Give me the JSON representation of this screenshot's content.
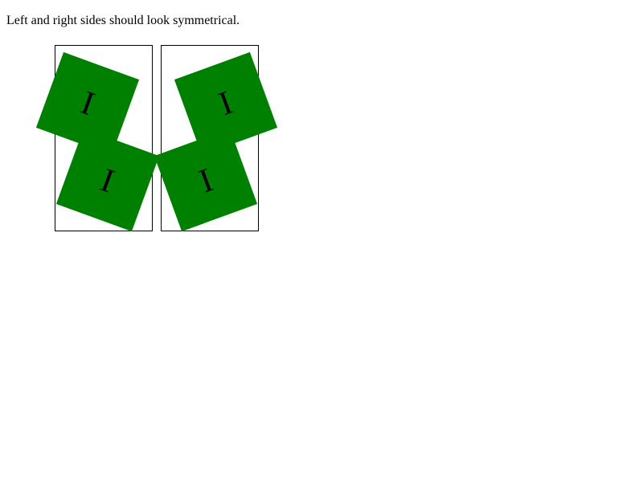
{
  "instruction": "Left and right sides should look symmetrical.",
  "colors": {
    "tile": "#008000",
    "border": "#000000",
    "background": "#ffffff"
  },
  "panels": [
    {
      "side": "left",
      "tiles": [
        {
          "glyph": "I"
        },
        {
          "glyph": "I"
        }
      ]
    },
    {
      "side": "right",
      "tiles": [
        {
          "glyph": "I"
        },
        {
          "glyph": "I"
        }
      ]
    }
  ]
}
